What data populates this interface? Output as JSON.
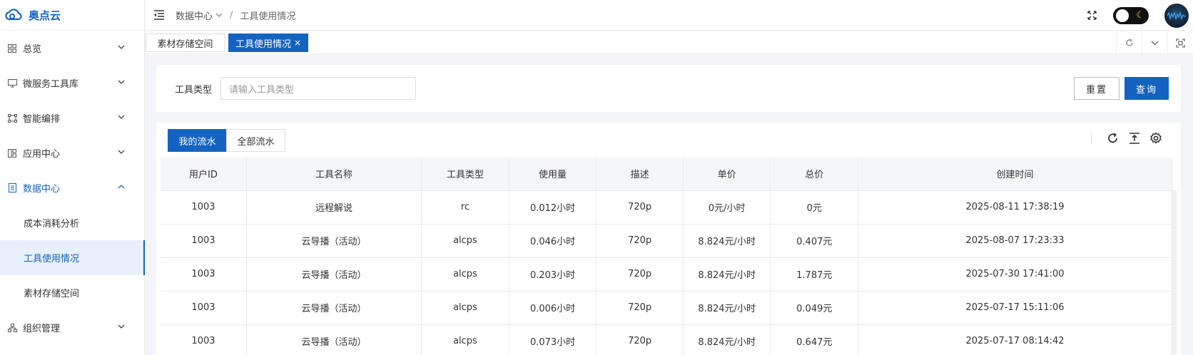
{
  "app": {
    "name": "奥点云"
  },
  "sidebar": {
    "items": [
      {
        "label": "总览",
        "icon": "grid-icon"
      },
      {
        "label": "微服务工具库",
        "icon": "monitor-icon"
      },
      {
        "label": "智能编排",
        "icon": "nodes-icon"
      },
      {
        "label": "应用中心",
        "icon": "apps-icon"
      },
      {
        "label": "数据中心",
        "icon": "document-icon"
      },
      {
        "label": "组织管理",
        "icon": "org-icon"
      }
    ],
    "sub_items": [
      {
        "label": "成本消耗分析"
      },
      {
        "label": "工具使用情况"
      },
      {
        "label": "素材存储空间"
      }
    ]
  },
  "header": {
    "breadcrumb_parent": "数据中心",
    "breadcrumb_sep": "/",
    "breadcrumb_current": "工具使用情况"
  },
  "tabs": [
    {
      "label": "素材存储空间"
    },
    {
      "label": "工具使用情况",
      "close": "×"
    }
  ],
  "search": {
    "label": "工具类型",
    "placeholder": "请输入工具类型",
    "reset_label": "重置",
    "query_label": "查询"
  },
  "segments": {
    "mine": "我的流水",
    "all": "全部流水"
  },
  "table": {
    "headers": [
      "用户ID",
      "工具名称",
      "工具类型",
      "使用量",
      "描述",
      "单价",
      "总价",
      "创建时间"
    ],
    "rows": [
      [
        "1003",
        "远程解说",
        "rc",
        "0.012小时",
        "720p",
        "0元/小时",
        "0元",
        "2025-08-11 17:38:19"
      ],
      [
        "1003",
        "云导播（活动）",
        "alcps",
        "0.046小时",
        "720p",
        "8.824元/小时",
        "0.407元",
        "2025-08-07 17:23:33"
      ],
      [
        "1003",
        "云导播（活动）",
        "alcps",
        "0.203小时",
        "720p",
        "8.824元/小时",
        "1.787元",
        "2025-07-30 17:41:00"
      ],
      [
        "1003",
        "云导播（活动）",
        "alcps",
        "0.006小时",
        "720p",
        "8.824元/小时",
        "0.049元",
        "2025-07-17 15:11:06"
      ],
      [
        "1003",
        "云导播（活动）",
        "alcps",
        "0.073小时",
        "720p",
        "8.824元/小时",
        "0.647元",
        "2025-07-17 08:14:42"
      ]
    ]
  },
  "colors": {
    "accent": "#1563c0",
    "active_bg": "#e8f0fb"
  }
}
